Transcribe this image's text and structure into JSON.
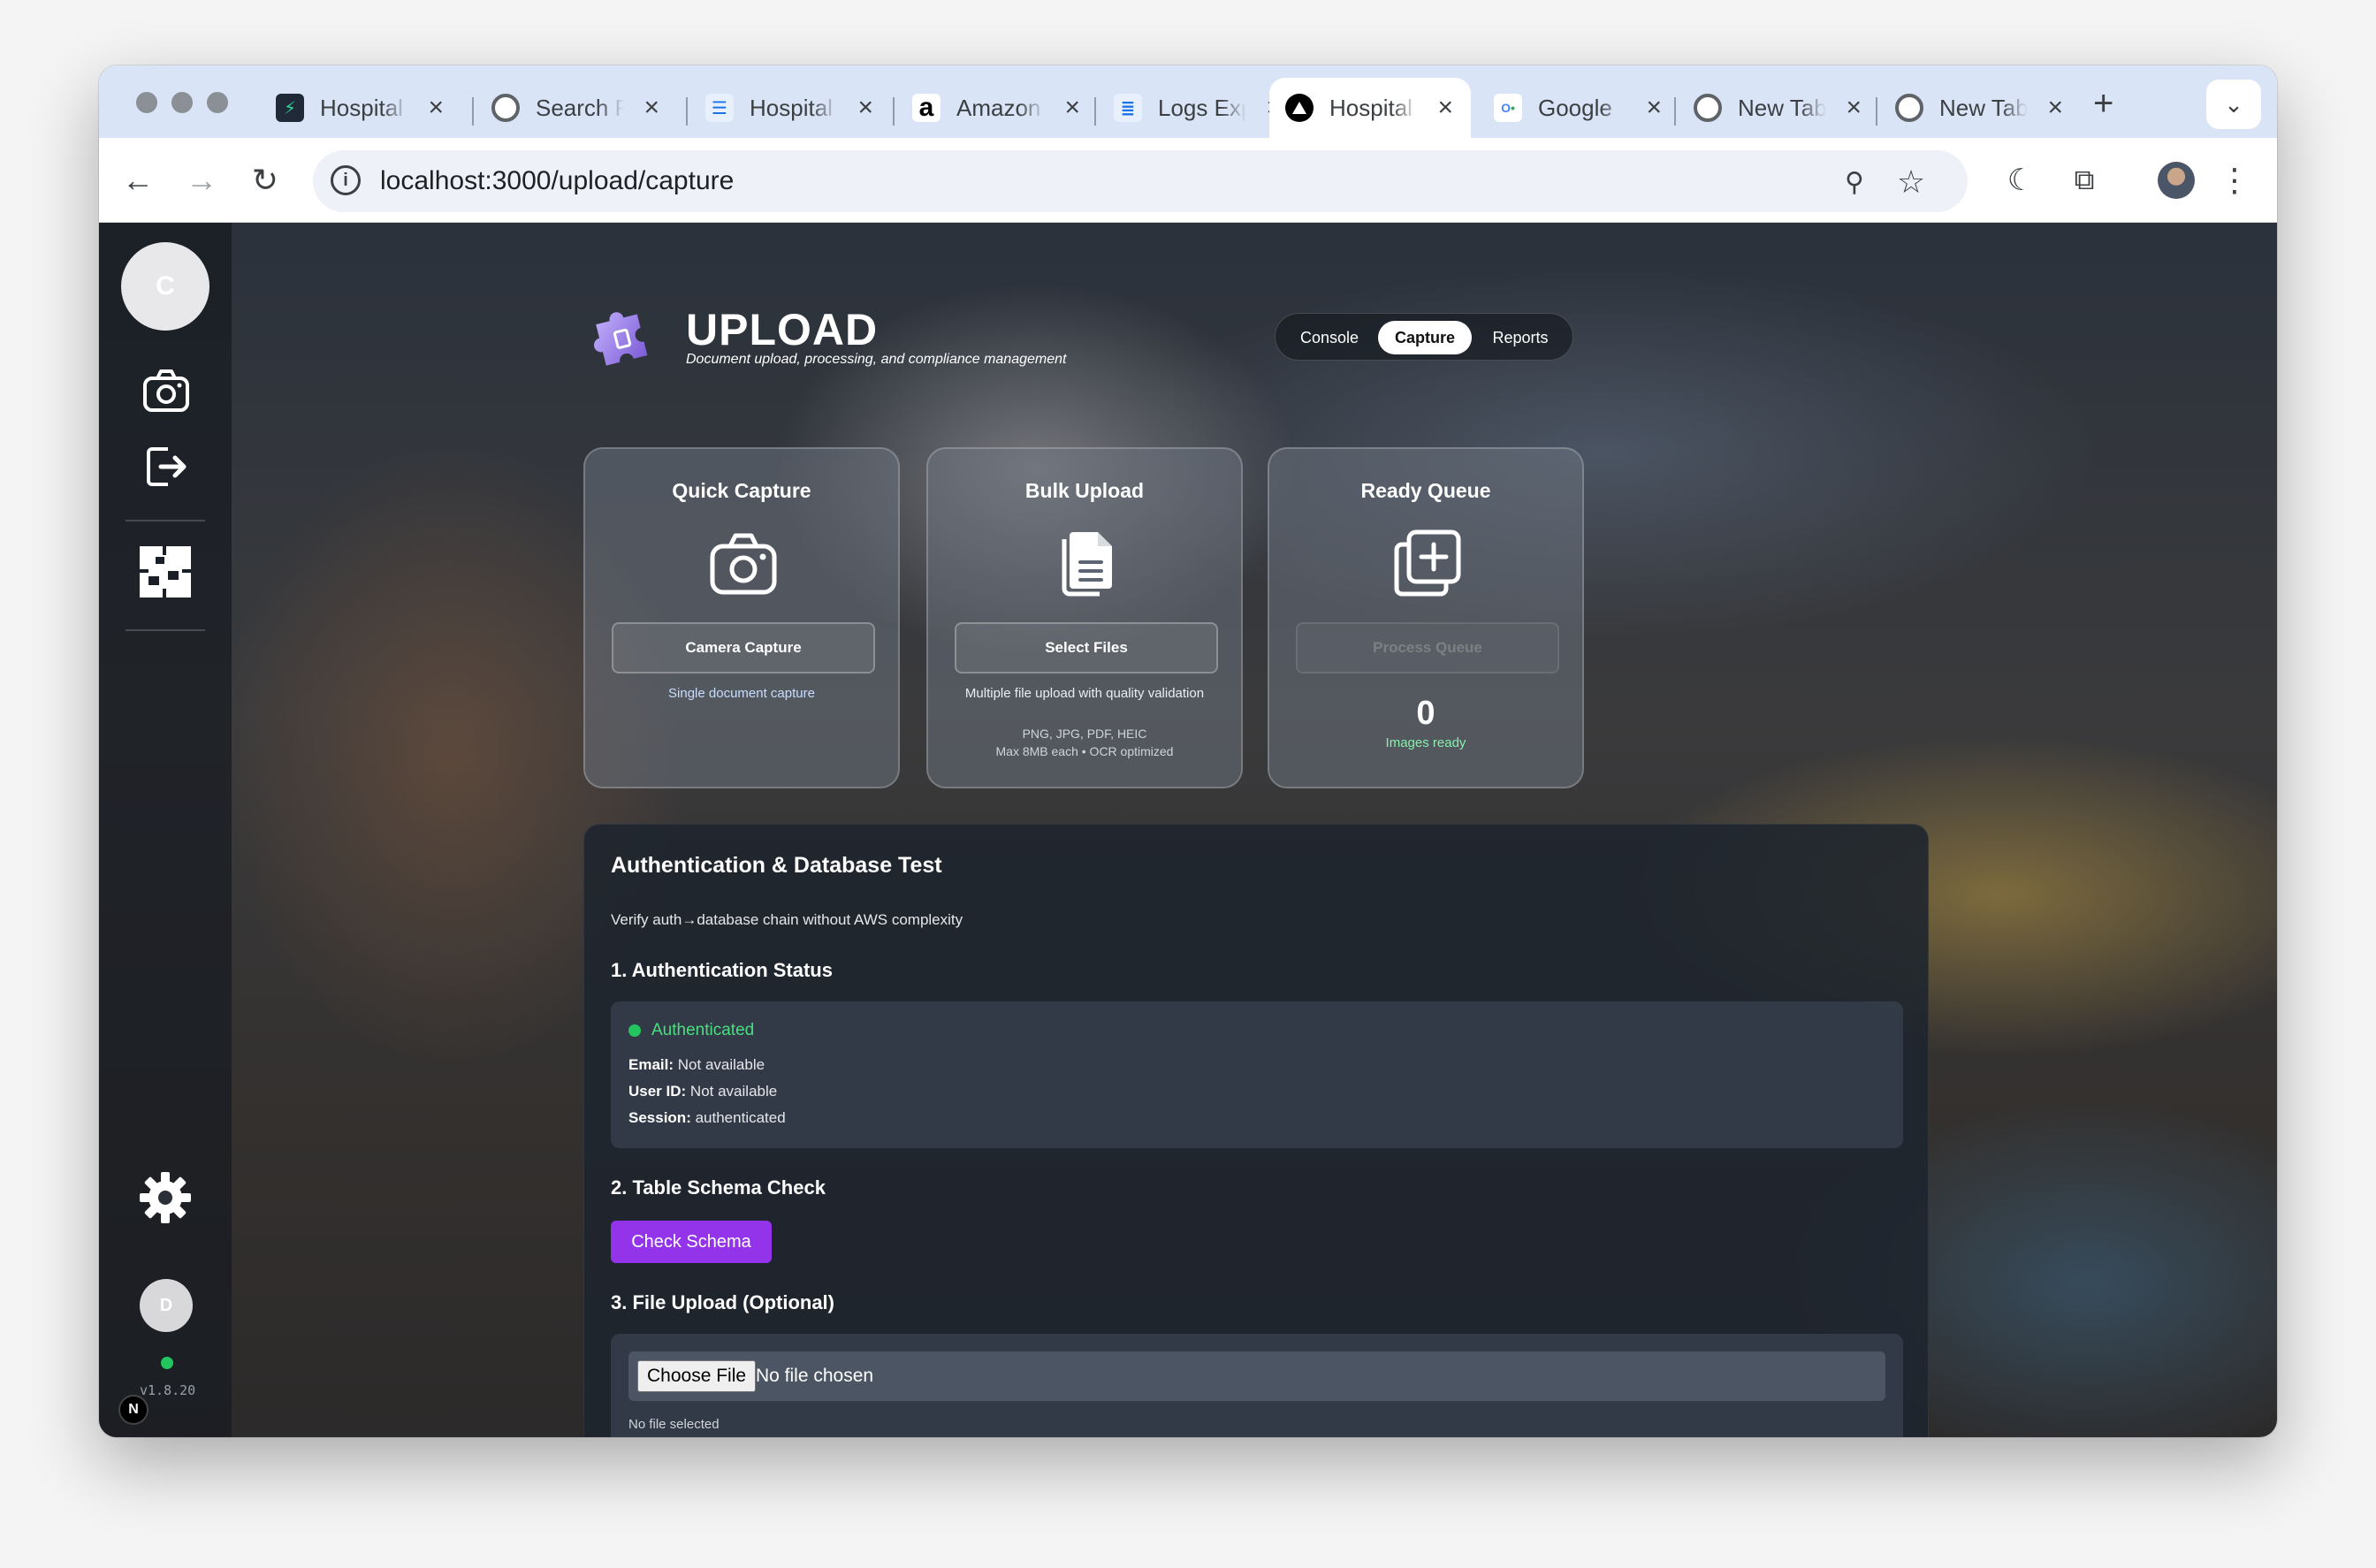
{
  "browser": {
    "tabs": [
      {
        "title": "Hospital Dashboard",
        "favicon_color": "#1f2937",
        "favicon": "bolt"
      },
      {
        "title": "Search Results",
        "favicon_color": "#5f6368",
        "favicon": "chrome"
      },
      {
        "title": "Hospital Schema",
        "favicon_color": "#1a73e8",
        "favicon": "list"
      },
      {
        "title": "Amazon Web Services",
        "favicon_color": "#000000",
        "favicon": "a"
      },
      {
        "title": "Logs Explorer",
        "favicon_color": "#1a73e8",
        "favicon": "logs"
      },
      {
        "title": "Hospital Upload",
        "favicon_color": "#000000",
        "favicon": "triangle"
      },
      {
        "title": "Google",
        "favicon_color": "#4285f4",
        "favicon": "google"
      },
      {
        "title": "New Tab",
        "favicon_color": "#5f6368",
        "favicon": "chrome"
      },
      {
        "title": "New Tab",
        "favicon_color": "#5f6368",
        "favicon": "chrome"
      }
    ],
    "active_tab_index": 5,
    "url": "localhost:3000/upload/capture"
  },
  "sidebar": {
    "user_initial": "C",
    "bottom_user_initial": "D",
    "version": "v1.8.20",
    "badge": "N"
  },
  "header": {
    "title": "UPLOAD",
    "subtitle": "Document upload, processing, and compliance management"
  },
  "nav": {
    "items": [
      "Console",
      "Capture",
      "Reports"
    ],
    "active": "Capture"
  },
  "cards": {
    "quick": {
      "title": "Quick Capture",
      "button": "Camera Capture",
      "description": "Single document capture"
    },
    "bulk": {
      "title": "Bulk Upload",
      "button": "Select Files",
      "description": "Multiple file upload with quality validation",
      "formats": "PNG, JPG, PDF, HEIC",
      "limits": "Max 8MB each • OCR optimized"
    },
    "queue": {
      "title": "Ready Queue",
      "button": "Process Queue",
      "count": "0",
      "count_label": "Images ready"
    }
  },
  "test_panel": {
    "title": "Authentication & Database Test",
    "description": "Verify auth→database chain without AWS complexity",
    "section1": "1. Authentication Status",
    "auth_status": "Authenticated",
    "email_label": "Email:",
    "email_value": "Not available",
    "user_id_label": "User ID:",
    "user_id_value": "Not available",
    "session_label": "Session:",
    "session_value": "authenticated",
    "section2": "2. Table Schema Check",
    "schema_button": "Check Schema",
    "section3": "3. File Upload (Optional)",
    "choose_file": "Choose File",
    "no_file_chosen": "No file chosen",
    "no_file_selected": "No file selected"
  },
  "colors": {
    "accent_purple": "#9333ea",
    "success_green": "#22c55e",
    "sidebar_bg": "#161a21"
  }
}
